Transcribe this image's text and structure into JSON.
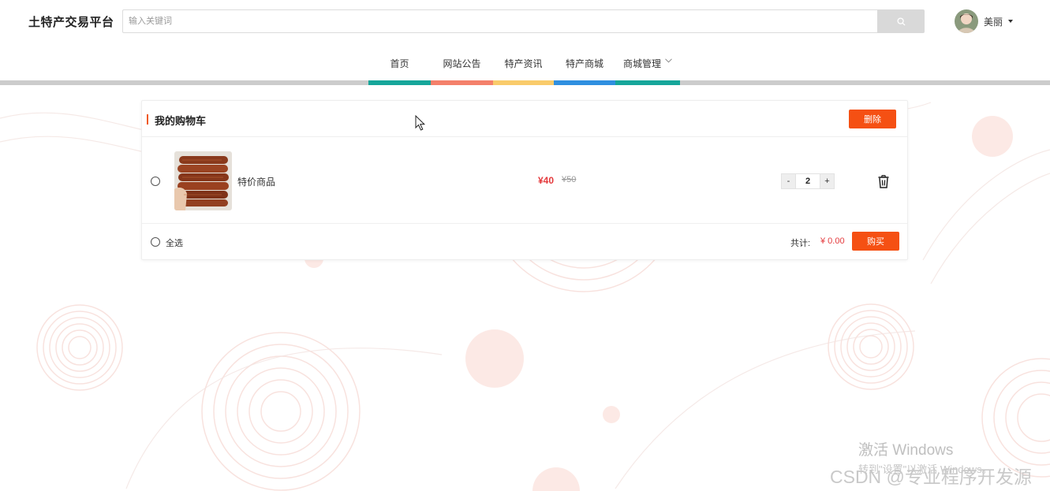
{
  "header": {
    "logo": "土特产交易平台",
    "search": {
      "placeholder": "输入关键词",
      "value": ""
    },
    "user": {
      "name": "美丽"
    }
  },
  "nav": {
    "items": [
      {
        "label": "首页",
        "color": "#16a69a"
      },
      {
        "label": "网站公告",
        "color": "#f4806b"
      },
      {
        "label": "特产资讯",
        "color": "#f9cb6b"
      },
      {
        "label": "特产商城",
        "color": "#2f8fe0"
      },
      {
        "label": "商城管理",
        "color": "#16a69a"
      }
    ]
  },
  "cart": {
    "title": "我的购物车",
    "delete_label": "删除",
    "items": [
      {
        "name": "特价商品",
        "price": "¥40",
        "original_price": "¥50",
        "quantity": "2"
      }
    ],
    "select_all_label": "全选",
    "total_label": "共计:",
    "total_value": "¥ 0.00",
    "buy_label": "购买"
  },
  "stepper": {
    "minus": "-",
    "plus": "+"
  },
  "watermark": {
    "activate_title": "激活 Windows",
    "activate_sub": "转到\"设置\"以激活 Windows。",
    "csdn": "CSDN @专业程序开发源"
  },
  "colors": {
    "accent": "#f55013",
    "price": "#e4393c",
    "divider": "#cccccc"
  },
  "icons": [
    "search-icon",
    "chevron-down-icon",
    "trash-icon",
    "cursor-icon"
  ]
}
